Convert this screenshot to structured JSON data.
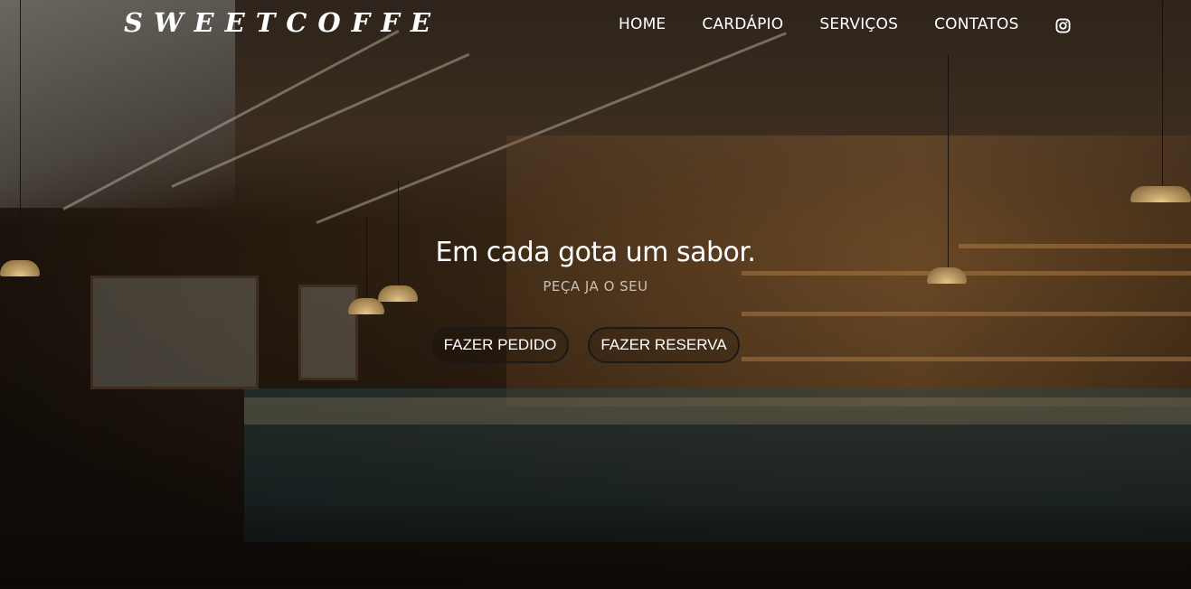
{
  "brand": {
    "logo": "SWEETCOFFE"
  },
  "nav": {
    "items": [
      {
        "label": "HOME"
      },
      {
        "label": "CARDÁPIO"
      },
      {
        "label": "SERVIÇOS"
      },
      {
        "label": "CONTATOS"
      }
    ],
    "social_icon": "instagram-icon"
  },
  "hero": {
    "headline": "Em cada gota um sabor.",
    "subheadline": "PEÇA JA O SEU",
    "buttons": [
      {
        "label": "FAZER PEDIDO"
      },
      {
        "label": "FAZER RESERVA"
      }
    ],
    "background_image": "dimmed-cafe-interior"
  },
  "colors": {
    "text": "#ffffff",
    "subtext": "#c8c0b8",
    "button_border": "#1a1a1a"
  }
}
